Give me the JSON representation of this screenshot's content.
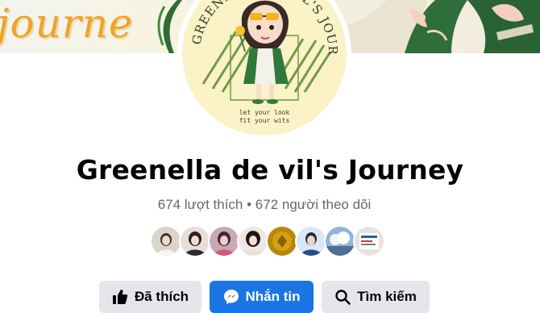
{
  "cover": {
    "script_text": "journe",
    "accent_color": "#f0a22a"
  },
  "avatar": {
    "ring_text": "GREENELLA DE VIL'S JOURNEY",
    "tagline_line1": "let your look",
    "tagline_line2": "fit your wits"
  },
  "page": {
    "title": "Greenella de vil's Journey",
    "stats": "674 lượt thích • 672 người theo dõi"
  },
  "friends": {
    "count_shown": 8
  },
  "actions": {
    "like_label": "Đã thích",
    "message_label": "Nhắn tin",
    "search_label": "Tìm kiếm"
  },
  "colors": {
    "primary": "#1b74e4",
    "secondary_bg": "#e4e6eb",
    "text_primary": "#050505",
    "text_secondary": "#65676b"
  }
}
